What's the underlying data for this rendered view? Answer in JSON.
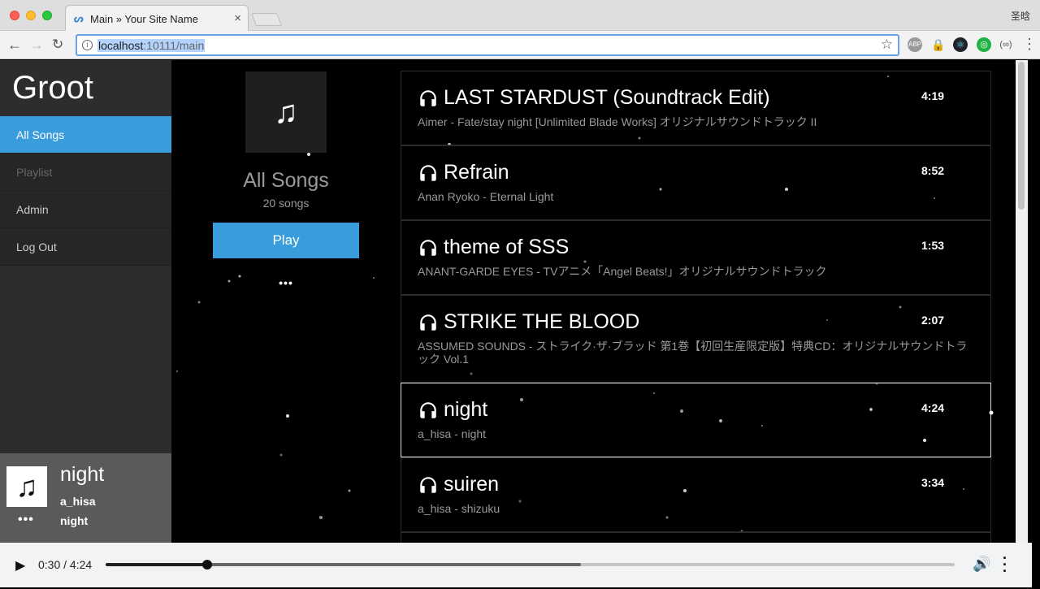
{
  "browser": {
    "tab_title": "Main » Your Site Name",
    "tab_close": "×",
    "profile_name": "圣晗",
    "url_host": "localhost",
    "url_path": ":10111/main"
  },
  "sidebar": {
    "brand": "Groot",
    "items": [
      {
        "label": "All Songs",
        "state": "active"
      },
      {
        "label": "Playlist",
        "state": "disabled"
      },
      {
        "label": "Admin",
        "state": "normal"
      },
      {
        "label": "Log Out",
        "state": "normal"
      }
    ],
    "now_playing": {
      "title": "night",
      "artist": "a_hisa",
      "album": "night",
      "more": "•••"
    }
  },
  "playlist": {
    "title": "All Songs",
    "count": "20 songs",
    "play_label": "Play",
    "more": "•••"
  },
  "songs": [
    {
      "title": "LAST STARDUST (Soundtrack Edit)",
      "subtitle": "Aimer - Fate/stay night [Unlimited Blade Works] オリジナルサウンドトラック II",
      "duration": "4:19"
    },
    {
      "title": "Refrain",
      "subtitle": "Anan Ryoko - Eternal Light",
      "duration": "8:52"
    },
    {
      "title": "theme of SSS",
      "subtitle": "ANANT-GARDE EYES - TVアニメ「Angel Beats!」オリジナルサウンドトラック",
      "duration": "1:53"
    },
    {
      "title": "STRIKE THE BLOOD",
      "subtitle": "ASSUMED SOUNDS - ストライク·ザ·ブラッド 第1巻【初回生産限定版】特典CD：オリジナルサウンドトラック Vol.1",
      "duration": "2:07"
    },
    {
      "title": "night",
      "subtitle": "a_hisa - night",
      "duration": "4:24"
    },
    {
      "title": "suiren",
      "subtitle": "a_hisa - shizuku",
      "duration": "3:34"
    }
  ],
  "player": {
    "time": "0:30 / 4:24",
    "played_fraction": 0.12,
    "buffered_fraction": 0.56
  }
}
